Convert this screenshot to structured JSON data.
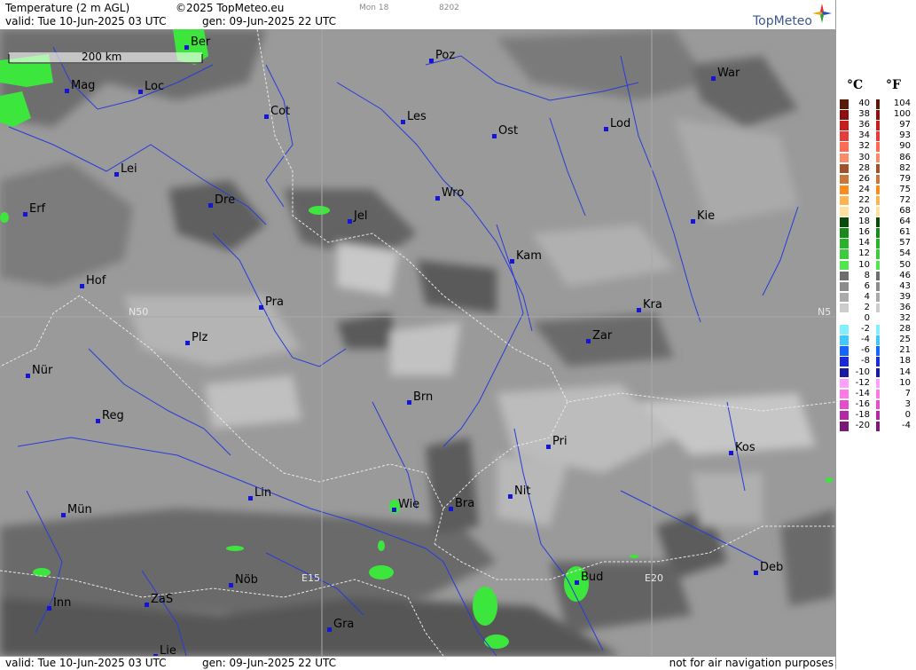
{
  "header": {
    "title": "Temperature (2 m AGL)",
    "copyright": "©2025 TopMeteo.eu",
    "model_tag": "Mon 18",
    "code_tag": "8202",
    "valid": "valid:  Tue  10-Jun-2025  03 UTC",
    "generated": "gen:  09-Jun-2025 22 UTC",
    "logo": "TopMeteo"
  },
  "footer": {
    "valid": "valid:  Tue  10-Jun-2025  03 UTC",
    "generated": "gen:  09-Jun-2025 22 UTC",
    "disclaimer": "not for air navigation purposes"
  },
  "map": {
    "scale_label": "200 km",
    "grid_labels": [
      "N50",
      "N5",
      "E15",
      "E20"
    ],
    "cities": [
      "Ber",
      "Poz",
      "War",
      "Mag",
      "Loc",
      "Cot",
      "Les",
      "Ost",
      "Lod",
      "Lei",
      "Dre",
      "Wro",
      "Jel",
      "Erf",
      "Kie",
      "Kam",
      "Hof",
      "Pra",
      "Kra",
      "Plz",
      "Zar",
      "Nür",
      "Brn",
      "Reg",
      "Pri",
      "Kos",
      "Lin",
      "Wie",
      "Bra",
      "Nit",
      "Mün",
      "Nöb",
      "Bud",
      "Deb",
      "Inn",
      "ZaS",
      "Gra",
      "Lie"
    ]
  },
  "legend": {
    "celsius_label": "°C",
    "fahrenheit_label": "°F",
    "celsius": [
      "40",
      "38",
      "36",
      "34",
      "32",
      "30",
      "28",
      "26",
      "24",
      "22",
      "20",
      "18",
      "16",
      "14",
      "12",
      "10",
      "8",
      "6",
      "4",
      "2",
      "0",
      "-2",
      "-4",
      "-6",
      "-8",
      "-10",
      "-12",
      "-14",
      "-16",
      "-18",
      "-20"
    ],
    "fahrenheit": [
      "104",
      "100",
      "97",
      "93",
      "90",
      "86",
      "82",
      "79",
      "75",
      "72",
      "68",
      "64",
      "61",
      "57",
      "54",
      "50",
      "46",
      "43",
      "39",
      "36",
      "32",
      "28",
      "25",
      "21",
      "18",
      "14",
      "10",
      "7",
      "3",
      "0",
      "-4"
    ],
    "colors": [
      "#5a1a0a",
      "#8b1010",
      "#c81e1e",
      "#e63c3c",
      "#ff6a50",
      "#ff8a6a",
      "#a0522d",
      "#c8783c",
      "#ff8c1a",
      "#ffb450",
      "#ffe0a0",
      "#0a4a0a",
      "#1a8a1a",
      "#28b428",
      "#3ccc3c",
      "#50e650",
      "#6e6e6e",
      "#8c8c8c",
      "#aaaaaa",
      "#cccccc",
      "#ffffff",
      "#80f0ff",
      "#40c8ff",
      "#1464ff",
      "#1a2ad8",
      "#1a1aa0",
      "#ffa0ff",
      "#ff78e6",
      "#e64ccc",
      "#b428a8",
      "#7a1a78"
    ]
  }
}
